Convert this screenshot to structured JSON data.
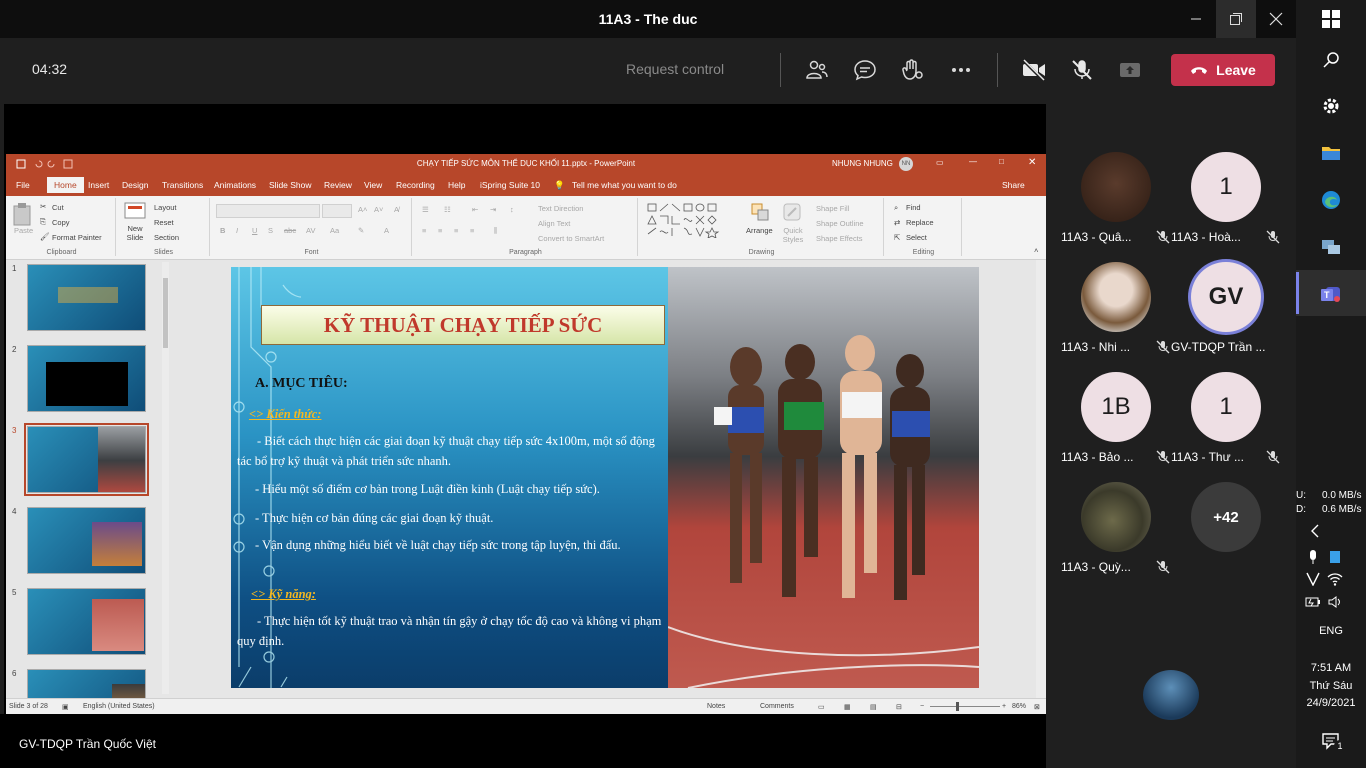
{
  "window": {
    "title": "11A3 - The duc",
    "controls": [
      "minimize-icon",
      "restore-icon",
      "close-icon"
    ]
  },
  "call": {
    "timer": "04:32",
    "request_control": "Request control",
    "leave_label": "Leave",
    "buttons": [
      "people-icon",
      "chat-icon",
      "reactions-icon",
      "more-icon",
      "camera-off-icon",
      "mic-off-icon",
      "share-tray-icon"
    ],
    "leave_color": "#c4314b"
  },
  "ppt": {
    "title": "CHẠY TIẾP SỨC MÔN THỂ DỤC KHỐI 11.pptx - PowerPoint",
    "user": "NHUNG NHUNG",
    "user_initials": "NN",
    "tabs": [
      "File",
      "Home",
      "Insert",
      "Design",
      "Transitions",
      "Animations",
      "Slide Show",
      "Review",
      "View",
      "Recording",
      "Help",
      "iSpring Suite 10"
    ],
    "tell_me": "Tell me what you want to do",
    "share": "Share",
    "ribbon": {
      "clipboard": {
        "label": "Clipboard",
        "paste": "Paste",
        "cut": "Cut",
        "copy": "Copy",
        "format_painter": "Format Painter"
      },
      "slides": {
        "label": "Slides",
        "new_slide": "New Slide",
        "layout": "Layout",
        "reset": "Reset",
        "section": "Section"
      },
      "font": {
        "label": "Font"
      },
      "paragraph": {
        "label": "Paragraph",
        "text_direction": "Text Direction",
        "align_text": "Align Text",
        "convert": "Convert to SmartArt"
      },
      "drawing": {
        "label": "Drawing",
        "arrange": "Arrange",
        "quick_styles": "Quick Styles",
        "shape_fill": "Shape Fill",
        "shape_outline": "Shape Outline",
        "shape_effects": "Shape Effects"
      },
      "editing": {
        "label": "Editing",
        "find": "Find",
        "replace": "Replace",
        "select": "Select"
      }
    },
    "thumbnails": [
      "1",
      "2",
      "3",
      "4",
      "5",
      "6"
    ],
    "slide": {
      "heading": "KỸ THUẬT CHẠY TIẾP SỨC",
      "section_a": "A. MỤC TIÊU:",
      "knowledge": "<> Kiến thức:",
      "k1": "- Biết cách thực hiện các giai đoạn kỹ thuật chạy tiếp sức 4x100m, một số động tác bổ trợ kỹ thuật và phát triển sức nhanh.",
      "k2": "- Hiểu một số điểm cơ bản trong Luật điền kinh (Luật chạy tiếp sức).",
      "k3": "- Thực hiện cơ bản đúng các giai đoạn kỹ thuật.",
      "k4": "- Vận dụng những hiểu biết về luật chạy tiếp sức trong tập luyện, thi đấu.",
      "skills": "<> Kỹ năng:",
      "s1": "- Thực hiện tốt kỹ thuật trao và nhận tín gậy ở chạy tốc độ cao và không vi phạm quy định."
    },
    "status": {
      "slide_of": "Slide 3 of 28",
      "language": "English (United States)",
      "notes": "Notes",
      "comments": "Comments",
      "zoom": "86%"
    }
  },
  "presenter_name": "GV-TDQP Trần Quốc Việt",
  "participants": [
    {
      "name": "11A3 - Quâ...",
      "avatar": "photo"
    },
    {
      "name": "11A3 - Hoà...",
      "avatar": "1"
    },
    {
      "name": "11A3 - Nhi ...",
      "avatar": "photo"
    },
    {
      "name": "GV-TDQP Trần ...",
      "avatar": "GV"
    },
    {
      "name": "11A3 - Bảo ...",
      "avatar": "1B"
    },
    {
      "name": "11A3 - Thư ...",
      "avatar": "1"
    },
    {
      "name": "11A3 - Quỳ...",
      "avatar": "photo"
    },
    {
      "name": "",
      "avatar": "+42"
    }
  ],
  "taskbar": {
    "apps": [
      "windows-start-icon",
      "search-icon",
      "settings-icon",
      "file-explorer-icon",
      "edge-icon",
      "network-app-icon",
      "teams-icon"
    ],
    "net_up": "U:",
    "net_up_val": "0.0 MB/s",
    "net_down": "D:",
    "net_down_val": "0.6 MB/s",
    "lang": "ENG",
    "time": "7:51 AM",
    "day": "Thứ Sáu",
    "date": "24/9/2021",
    "notifications": "1"
  }
}
